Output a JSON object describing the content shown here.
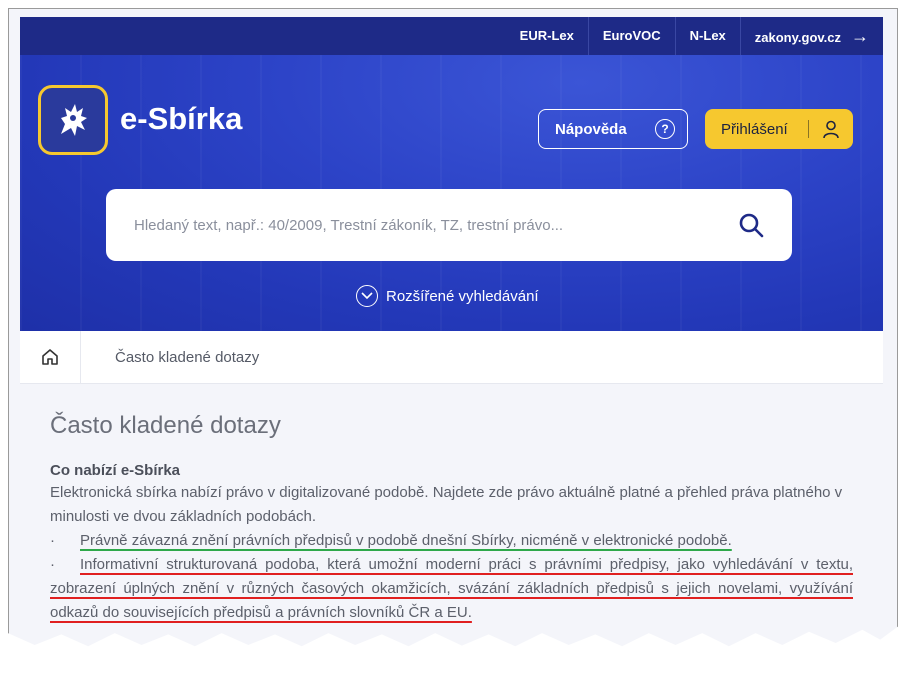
{
  "topbar": {
    "links": [
      "EUR-Lex",
      "EuroVOC",
      "N-Lex",
      "zakony.gov.cz"
    ],
    "arrow": "→"
  },
  "header": {
    "brand": "e-Sbírka",
    "help_label": "Nápověda",
    "help_icon": "?",
    "login_label": "Přihlášení"
  },
  "search": {
    "placeholder": "Hledaný text, např.: 40/2009, Trestní zákoník, TZ, trestní právo..."
  },
  "advanced_search": "Rozšířené vyhledávání",
  "breadcrumb": {
    "current": "Často kladené dotazy"
  },
  "content": {
    "title": "Často kladené dotazy",
    "section_title": "Co nabízí e-Sbírka",
    "intro": "Elektronická sbírka nabízí právo v digitalizované podobě. Najdete zde právo aktuálně platné a přehled práva platného v minulosti ve dvou základních podobách.",
    "bullet_char": "·",
    "bullet1": "Právně závazná znění právních předpisů v podobě dnešní Sbírky, nicméně v elektronické podobě.",
    "bullet2": "Informativní strukturovaná podoba, která umožní moderní práci s právními předpisy, jako vyhledávání v textu, zobrazení úplných znění v různých časových okamžicích, svázání základních předpisů s jejich novelami, využívání odkazů do souvisejících předpisů a právních slovníků ČR a EU."
  },
  "colors": {
    "topbar": "#1e2a87",
    "hero": "#2c43c7",
    "accent_yellow": "#f6c82f",
    "highlight_green": "#2ea84a",
    "highlight_red": "#e02020"
  }
}
